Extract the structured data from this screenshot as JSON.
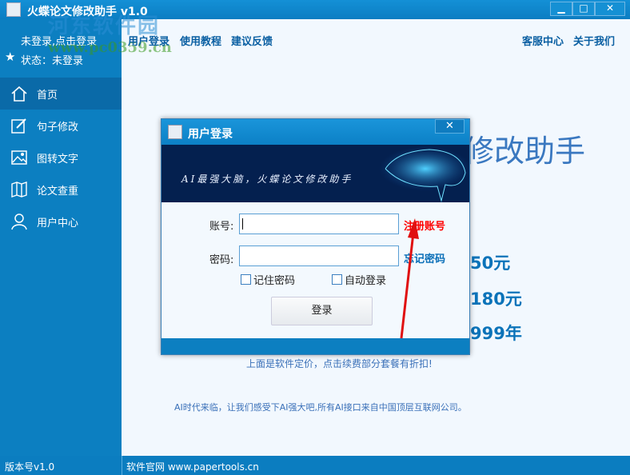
{
  "window": {
    "title": "火蝶论文修改助手 v1.0",
    "minimize": "▁",
    "maximize": "□",
    "close": "✕"
  },
  "watermark": {
    "line1": "河东软件园",
    "line2": "www.pc0359.cn"
  },
  "user": {
    "login_prompt": "未登录,点击登录",
    "status": "状态：未登录"
  },
  "header": {
    "links": [
      "用户登录",
      "使用教程",
      "建议反馈"
    ],
    "right_links": [
      "客服中心",
      "关于我们"
    ]
  },
  "sidebar": {
    "items": [
      {
        "label": "首页",
        "icon": "home-icon"
      },
      {
        "label": "句子修改",
        "icon": "edit-icon"
      },
      {
        "label": "图转文字",
        "icon": "image-icon"
      },
      {
        "label": "论文查重",
        "icon": "map-icon"
      },
      {
        "label": "用户中心",
        "icon": "user-icon"
      }
    ]
  },
  "main": {
    "title_fragment": "修改助手",
    "price_fragments": [
      "50元",
      "180元",
      "999年"
    ],
    "pricing_note": "上面是软件定价，点击续费部分套餐有折扣!",
    "footer_note": "AI时代来临，让我们感受下AI强大吧,所有AI接口来自中国顶层互联网公司。"
  },
  "status": {
    "version": "版本号v1.0",
    "website": "软件官网 www.papertools.cn"
  },
  "dialog": {
    "title": "用户登录",
    "close": "✕",
    "banner_text": "AI最强大脑，火蝶论文修改助手",
    "account_label": "账号:",
    "account_value": "",
    "password_label": "密码:",
    "password_value": "",
    "register_link": "注册账号",
    "forgot_link": "忘记密码",
    "remember": "记住密码",
    "auto_login": "自动登录",
    "login_button": "登录"
  },
  "colors": {
    "accent": "#0c7fc1",
    "register": "#ff0000",
    "link": "#0a6fb8"
  }
}
